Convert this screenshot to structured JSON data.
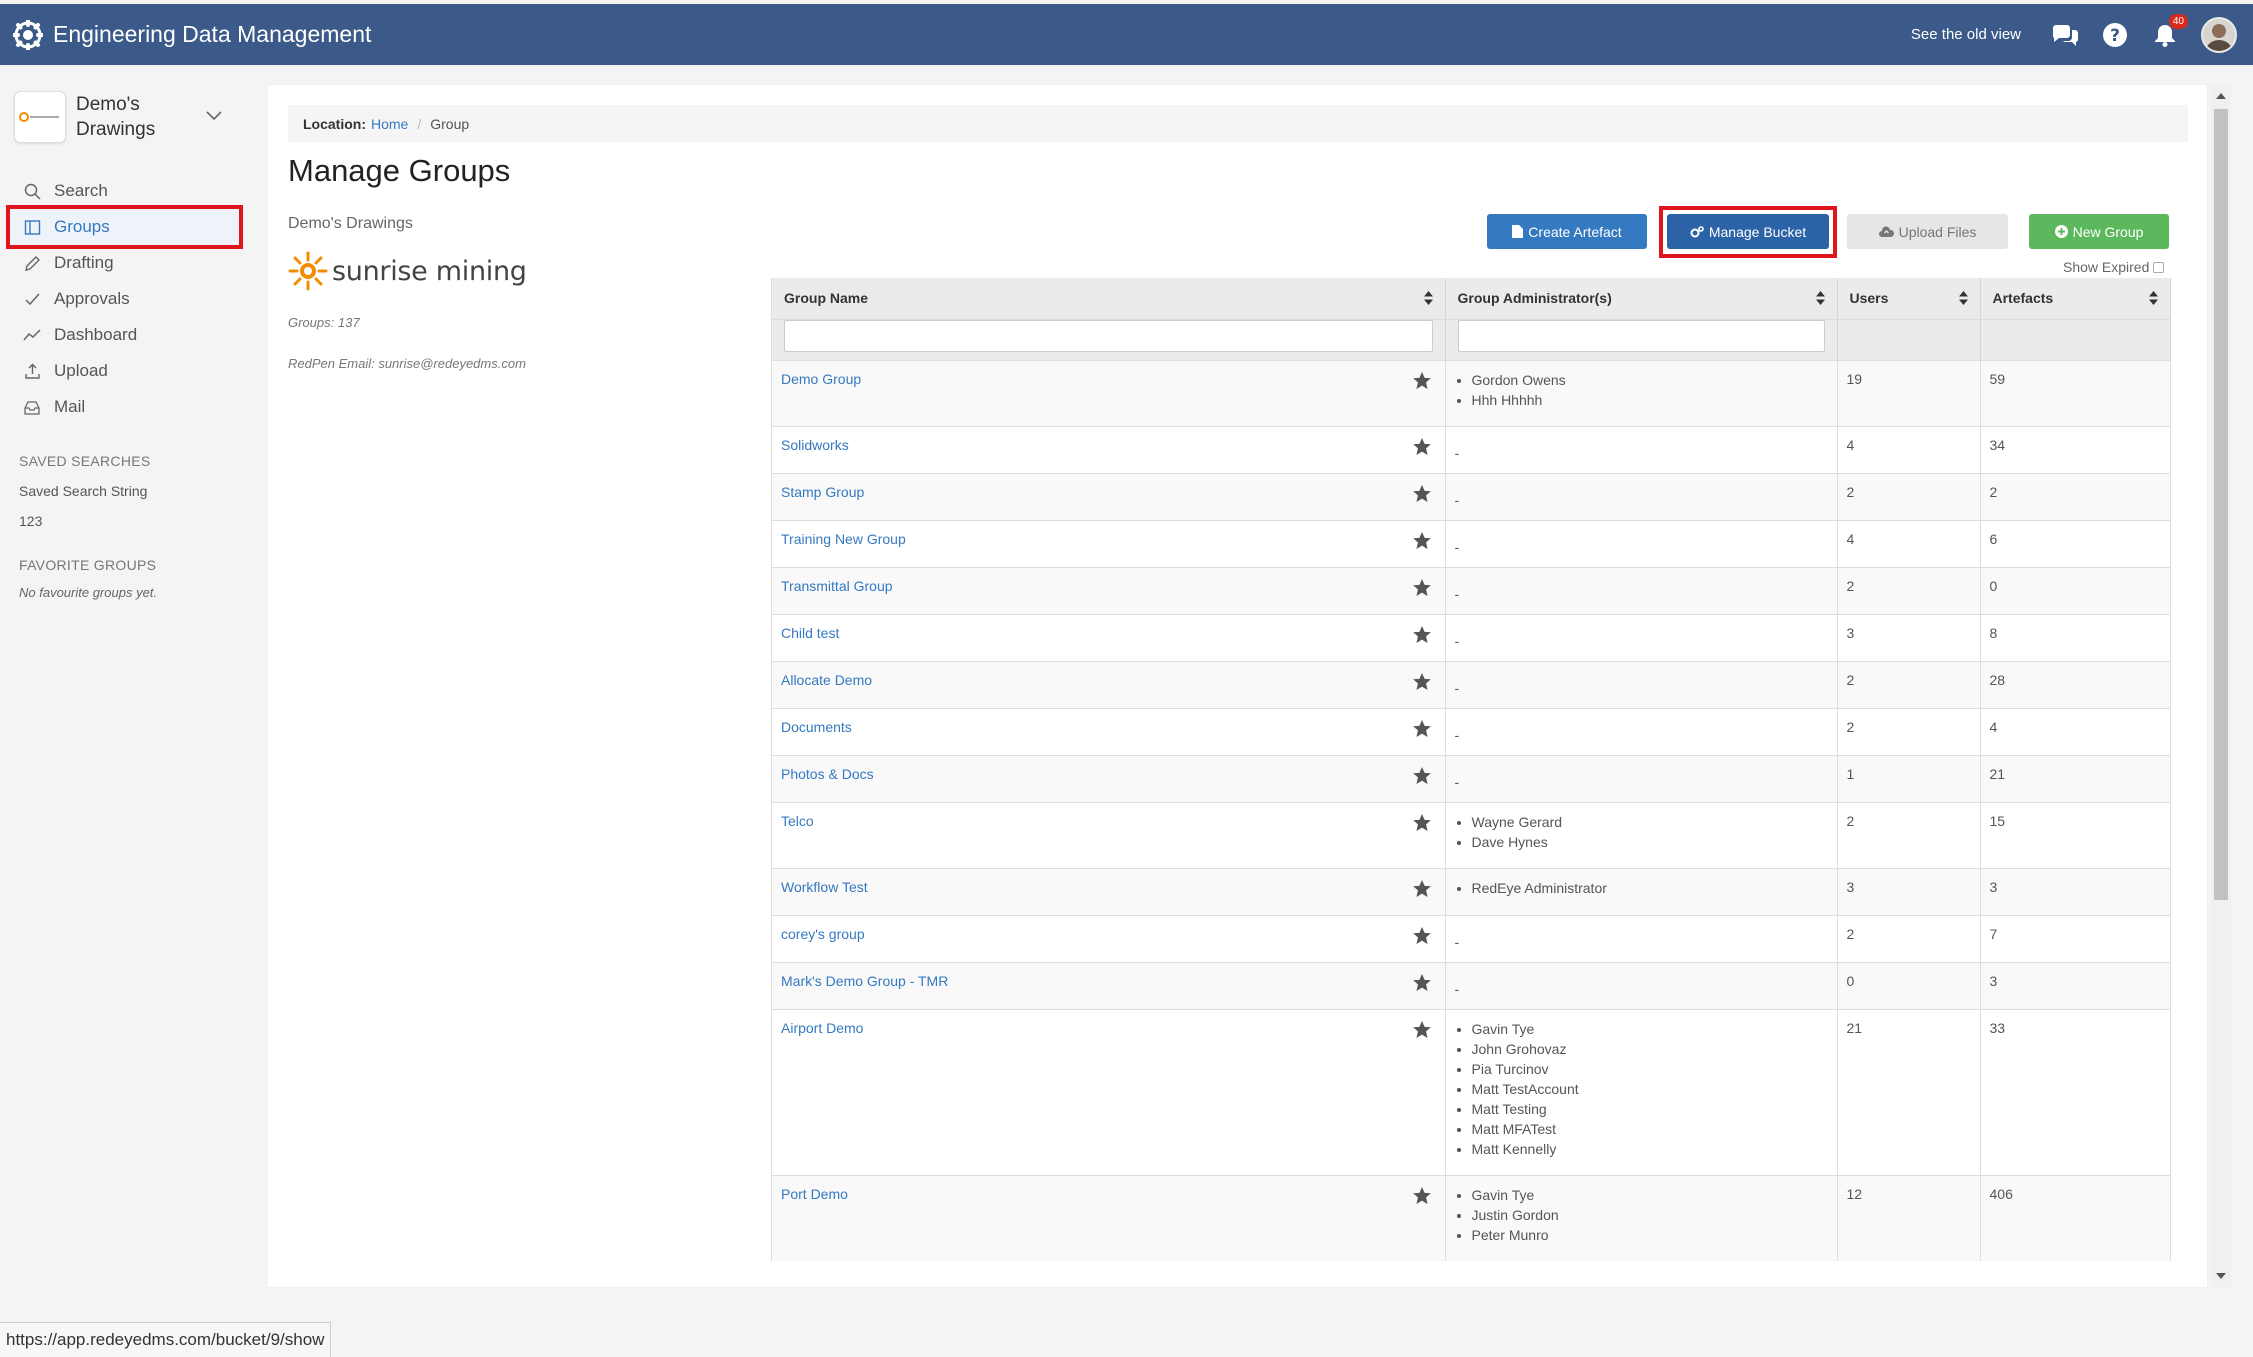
{
  "app": {
    "title": "Engineering Data Management"
  },
  "topbar": {
    "old_view": "See the old view",
    "notification_count": "40"
  },
  "sidebar": {
    "org_name": "Demo's Drawings",
    "nav": [
      {
        "label": "Search",
        "icon": "search-icon"
      },
      {
        "label": "Groups",
        "icon": "groups-icon",
        "active": true
      },
      {
        "label": "Drafting",
        "icon": "pencil-icon"
      },
      {
        "label": "Approvals",
        "icon": "check-icon"
      },
      {
        "label": "Dashboard",
        "icon": "chart-line-icon"
      },
      {
        "label": "Upload",
        "icon": "upload-icon"
      },
      {
        "label": "Mail",
        "icon": "inbox-icon"
      }
    ],
    "saved_searches_heading": "SAVED SEARCHES",
    "saved_searches": [
      "Saved Search String",
      "123"
    ],
    "favorite_groups_heading": "FAVORITE GROUPS",
    "favorite_groups_empty": "No favourite groups yet."
  },
  "breadcrumb": {
    "location_label": "Location:",
    "home": "Home",
    "current": "Group"
  },
  "page": {
    "title": "Manage Groups",
    "org_label": "Demo's Drawings",
    "brand_text": "sunrise mining",
    "groups_count": "Groups: 137",
    "redpen_email": "RedPen Email: sunrise@redeyedms.com"
  },
  "actions": {
    "create_artefact": "Create Artefact",
    "manage_bucket": "Manage Bucket",
    "upload_files": "Upload Files",
    "new_group": "New Group",
    "show_expired": "Show Expired"
  },
  "table": {
    "columns": [
      "Group Name",
      "Group Administrator(s)",
      "Users",
      "Artefacts"
    ],
    "rows": [
      {
        "name": "Demo Group",
        "admins": [
          "Gordon Owens",
          "Hhh Hhhhh"
        ],
        "users": "19",
        "artefacts": "59"
      },
      {
        "name": "Solidworks",
        "admins": [],
        "users": "4",
        "artefacts": "34"
      },
      {
        "name": "Stamp Group",
        "admins": [],
        "users": "2",
        "artefacts": "2"
      },
      {
        "name": "Training New Group",
        "admins": [],
        "users": "4",
        "artefacts": "6"
      },
      {
        "name": "Transmittal Group",
        "admins": [],
        "users": "2",
        "artefacts": "0"
      },
      {
        "name": "Child test",
        "admins": [],
        "users": "3",
        "artefacts": "8"
      },
      {
        "name": "Allocate Demo",
        "admins": [],
        "users": "2",
        "artefacts": "28"
      },
      {
        "name": "Documents",
        "admins": [],
        "users": "2",
        "artefacts": "4"
      },
      {
        "name": "Photos & Docs",
        "admins": [],
        "users": "1",
        "artefacts": "21"
      },
      {
        "name": "Telco",
        "admins": [
          "Wayne Gerard",
          "Dave Hynes"
        ],
        "users": "2",
        "artefacts": "15"
      },
      {
        "name": "Workflow Test",
        "admins": [
          "RedEye Administrator"
        ],
        "users": "3",
        "artefacts": "3"
      },
      {
        "name": "corey's group",
        "admins": [],
        "users": "2",
        "artefacts": "7"
      },
      {
        "name": "Mark's Demo Group - TMR",
        "admins": [],
        "users": "0",
        "artefacts": "3"
      },
      {
        "name": "Airport Demo",
        "admins": [
          "Gavin Tye",
          "John Grohovaz",
          "Pia Turcinov",
          "Matt TestAccount",
          "Matt Testing",
          "Matt MFATest",
          "Matt Kennelly"
        ],
        "users": "21",
        "artefacts": "33"
      },
      {
        "name": "Port Demo",
        "admins": [
          "Gavin Tye",
          "Justin Gordon",
          "Peter Munro"
        ],
        "users": "12",
        "artefacts": "406"
      }
    ],
    "empty_admin": "-"
  },
  "statusbar": {
    "url": "https://app.redeyedms.com/bucket/9/show"
  },
  "colors": {
    "topbar": "#3b5a89",
    "link": "#3579c0",
    "highlight": "#e0141b",
    "success": "#5cb85c"
  }
}
